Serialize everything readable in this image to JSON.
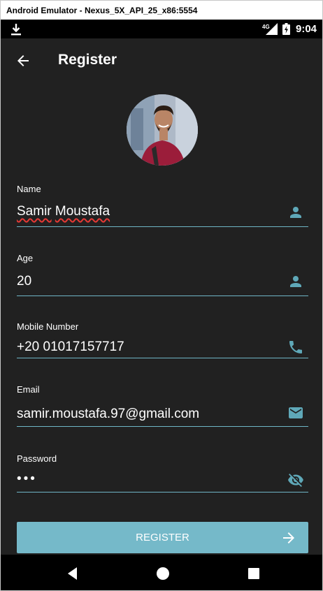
{
  "window": {
    "title": "Android Emulator - Nexus_5X_API_25_x86:5554"
  },
  "status_bar": {
    "network": "4G",
    "time": "9:04"
  },
  "app_bar": {
    "title": "Register"
  },
  "form": {
    "name": {
      "label": "Name",
      "value_words": [
        "Samir",
        "Moustafa"
      ],
      "icon": "person-icon"
    },
    "age": {
      "label": "Age",
      "value": "20",
      "icon": "person-icon"
    },
    "mobile": {
      "label": "Mobile Number",
      "value": "+20 01017157717",
      "icon": "phone-icon"
    },
    "email": {
      "label": "Email",
      "value": "samir.moustafa.97@gmail.com",
      "icon": "mail-icon"
    },
    "password": {
      "label": "Password",
      "value": "•••",
      "icon": "visibility-off-icon"
    }
  },
  "register_button": {
    "label": "REGISTER"
  },
  "colors": {
    "accent": "#75b9c9",
    "background": "#212121",
    "icon": "#5fa8b8"
  }
}
